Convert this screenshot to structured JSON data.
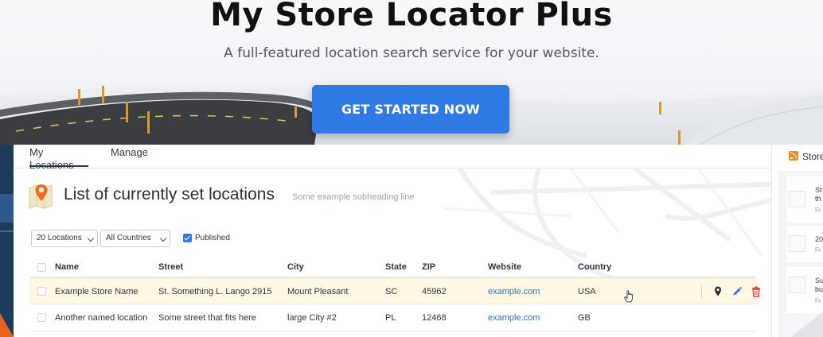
{
  "hero": {
    "title": "My Store Locator Plus",
    "subtitle": "A full-featured location search service for your website.",
    "cta_label": "GET STARTED NOW",
    "cta_color": "#2f7ae5"
  },
  "tabs": [
    {
      "label": "My Locations",
      "active": true
    },
    {
      "label": "Manage",
      "active": false
    }
  ],
  "page": {
    "heading": "List of currently set locations",
    "subheading": "Some example subheading line",
    "icon": "map-pin-icon"
  },
  "filters": {
    "count_select": "20 Locations",
    "country_select": "All Countries",
    "published_label": "Published",
    "published_checked": true
  },
  "table": {
    "columns": [
      "Name",
      "Street",
      "City",
      "State",
      "ZIP",
      "Website",
      "Country"
    ],
    "rows": [
      {
        "name": "Example Store Name",
        "street": "St. Something L. Lango 2915",
        "city": "Mount Pleasant",
        "state": "SC",
        "zip": "45962",
        "website": "example.com",
        "country": "USA",
        "highlighted": true
      },
      {
        "name": "Another named location",
        "street": "Some street that fits here",
        "city": "large City #2",
        "state": "PL",
        "zip": "12468",
        "website": "example.com",
        "country": "GB",
        "highlighted": false
      }
    ],
    "row_actions": [
      "location-pin-icon",
      "edit-pencil-icon",
      "delete-trash-icon"
    ]
  },
  "right_panel": {
    "title": "Store",
    "icon": "rss-icon",
    "items": [
      {
        "title_1": "St",
        "title_2": "th",
        "meta": "Fr"
      },
      {
        "title_1": "20",
        "title_2": "",
        "meta": "Fr"
      },
      {
        "title_1": "Su",
        "title_2": "bu",
        "meta": "Fr"
      }
    ]
  },
  "colors": {
    "sidebar_dark": "#1f3b5c",
    "accent_orange": "#e8641b",
    "link_blue": "#2f6fc9",
    "highlight_row": "#fdf7e3"
  }
}
